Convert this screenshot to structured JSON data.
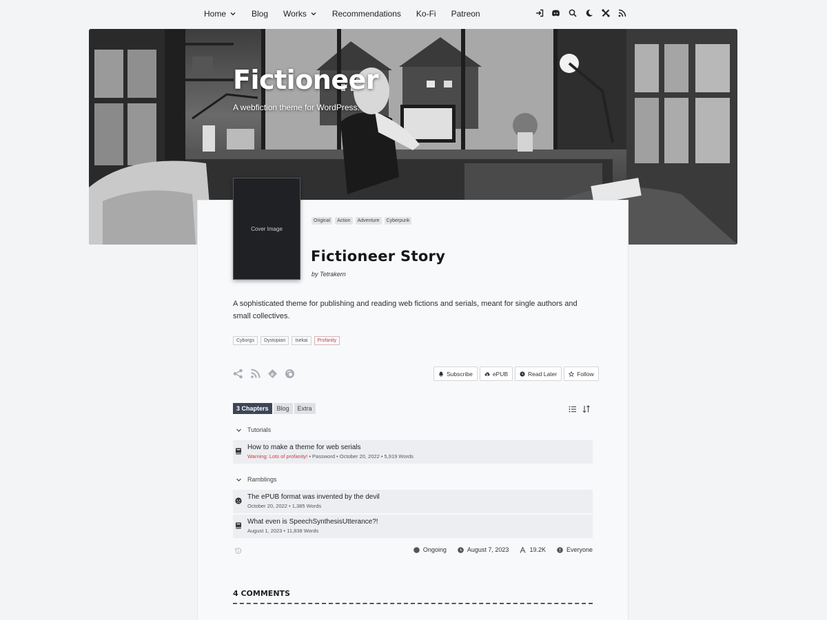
{
  "nav": {
    "items": [
      {
        "label": "Home",
        "dropdown": true
      },
      {
        "label": "Blog",
        "dropdown": false
      },
      {
        "label": "Works",
        "dropdown": true
      },
      {
        "label": "Recommendations",
        "dropdown": false
      },
      {
        "label": "Ko-Fi",
        "dropdown": false
      },
      {
        "label": "Patreon",
        "dropdown": false
      }
    ],
    "icons": [
      "login-icon",
      "discord-icon",
      "search-icon",
      "moon-icon",
      "settings-icon",
      "rss-icon"
    ]
  },
  "header": {
    "title": "Fictioneer",
    "tagline": "A webfiction theme for WordPress."
  },
  "story": {
    "cover_label": "Cover Image",
    "genres": [
      "Original",
      "Action",
      "Adventure",
      "Cyberpunk"
    ],
    "title": "Fictioneer Story",
    "by": "by",
    "author": "Tetrakern",
    "description": "A sophisticated theme for publishing and reading web fictions and serials, meant for single authors and small collectives.",
    "content_tags": [
      "Cyborgs",
      "Dystopian",
      "Isekai",
      "Profanity"
    ],
    "share_icons": [
      "share-icon",
      "rss-icon",
      "feedly-icon",
      "inoreader-icon"
    ],
    "actions": [
      "Subscribe",
      "ePUB",
      "Read Later",
      "Follow"
    ]
  },
  "tabs": [
    "3 Chapters",
    "Blog",
    "Extra"
  ],
  "groups": [
    {
      "name": "Tutorials",
      "chapters": [
        {
          "title": "How to make a theme for web serials",
          "warning": "Warning: Lots of profanity!",
          "meta": " • Password • October 20, 2022 • 5,919 Words",
          "icon": "book-icon"
        }
      ]
    },
    {
      "name": "Ramblings",
      "chapters": [
        {
          "title": "The ePUB format was invented by the devil",
          "warning": "",
          "meta": "October 20, 2022 • 1,385 Words",
          "icon": "angry-face-icon"
        },
        {
          "title": "What even is SpeechSynthesisUtterance?!",
          "warning": "",
          "meta": "August 1, 2023 • 11,838 Words",
          "icon": "book-icon"
        }
      ]
    }
  ],
  "stats": {
    "status": "Ongoing",
    "date": "August 7, 2023",
    "words": "19.2K",
    "rating": "Everyone"
  },
  "comments": {
    "heading": "4 COMMENTS"
  }
}
